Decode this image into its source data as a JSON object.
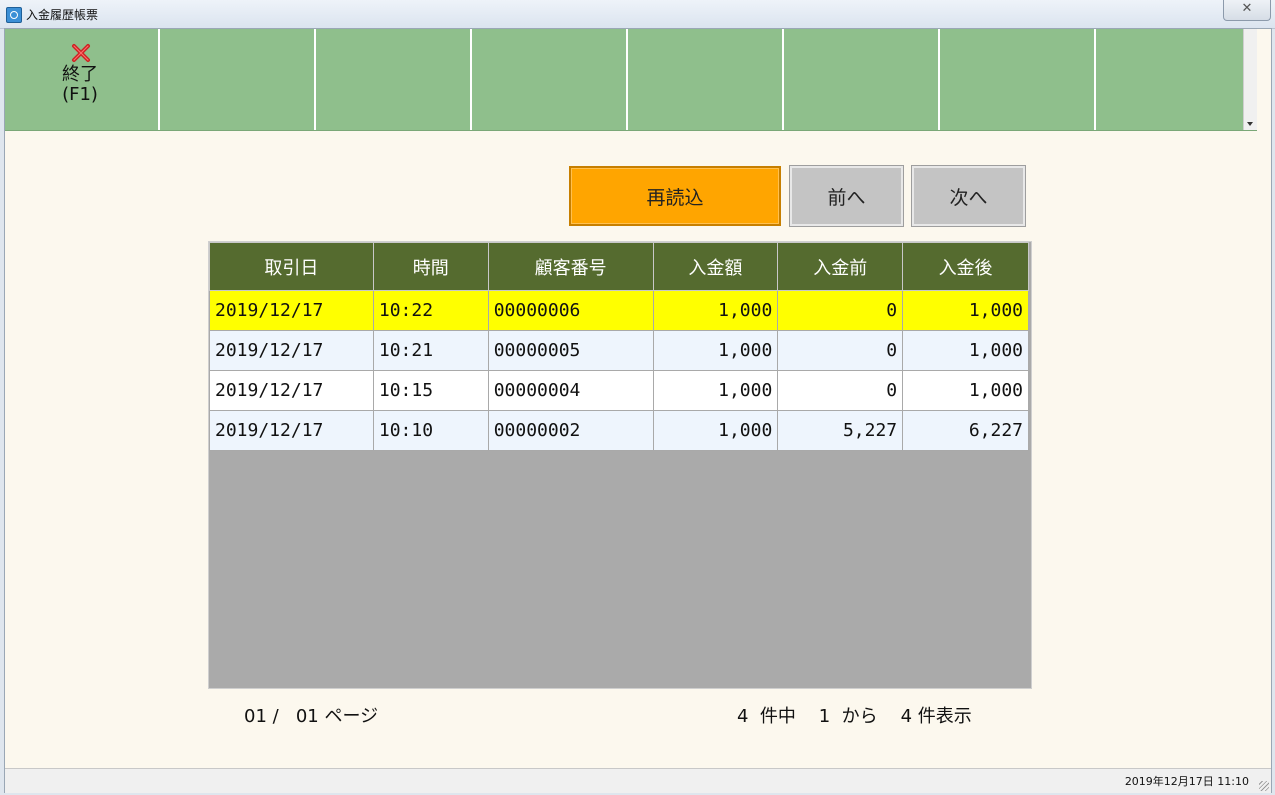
{
  "window": {
    "title": "入金履歴帳票",
    "close_glyph": "✕"
  },
  "toolbar": {
    "exit": {
      "label": "終了",
      "key": "(F1)",
      "icon": "close-x-icon",
      "icon_color": "#cc2222"
    },
    "slot_count": 7,
    "background": "#8fbf8c"
  },
  "actions": {
    "reload_label": "再読込",
    "prev_label": "前へ",
    "next_label": "次へ",
    "reload_color": "#ffa500"
  },
  "table": {
    "columns": [
      "取引日",
      "時間",
      "顧客番号",
      "入金額",
      "入金前",
      "入金後"
    ],
    "header_color": "#556b2f",
    "selected_color": "#ffff00",
    "rows": [
      [
        "2019/12/17",
        "10:22",
        "00000006",
        "1,000",
        "0",
        "1,000"
      ],
      [
        "2019/12/17",
        "10:21",
        "00000005",
        "1,000",
        "0",
        "1,000"
      ],
      [
        "2019/12/17",
        "10:15",
        "00000004",
        "1,000",
        "0",
        "1,000"
      ],
      [
        "2019/12/17",
        "10:10",
        "00000002",
        "1,000",
        "5,227",
        "6,227"
      ]
    ]
  },
  "pager": {
    "text": "01 /   01 ページ"
  },
  "count": {
    "text": "4  件中    1  から    4 件表示"
  },
  "status": {
    "datetime": "2019年12月17日 11:10"
  }
}
